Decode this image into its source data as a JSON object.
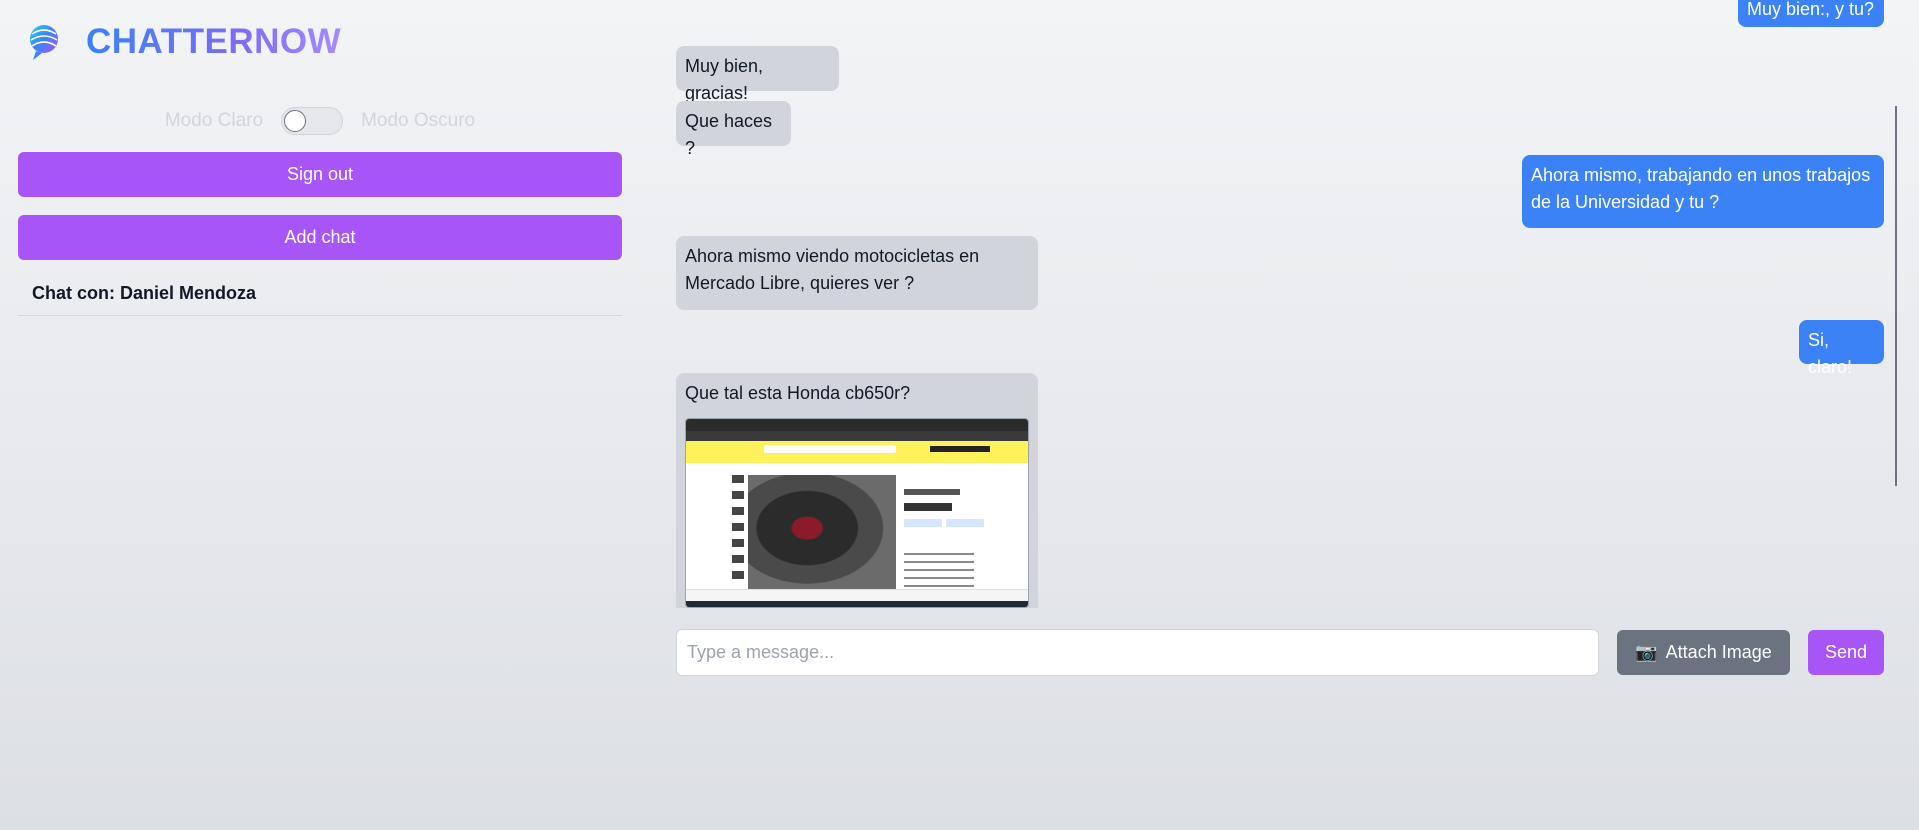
{
  "app": {
    "title": "CHATTERNOW",
    "logo_icon": "globe-chat-icon",
    "colors": {
      "accent_purple": "#a855f7",
      "outgoing_blue": "#3b82f6",
      "incoming_gray": "#d1d5db",
      "attach_gray": "#6b7280"
    }
  },
  "sidebar": {
    "mode_light_label": "Modo Claro",
    "mode_dark_label": "Modo Oscuro",
    "dark_mode_enabled": false,
    "sign_out_label": "Sign out",
    "add_chat_label": "Add chat",
    "chats": [
      {
        "label": "Chat con: Daniel Mendoza"
      }
    ]
  },
  "messages": [
    {
      "direction": "out",
      "text": "Muy bien:, y tu?"
    },
    {
      "direction": "in",
      "text": "Muy bien, gracias!"
    },
    {
      "direction": "in",
      "text": "Que haces ?"
    },
    {
      "direction": "out",
      "text": "Ahora mismo, trabajando en unos trabajos de la Universidad y tu ?"
    },
    {
      "direction": "in",
      "text": "Ahora mismo viendo motocicletas en Mercado Libre, quieres ver ?"
    },
    {
      "direction": "out",
      "text": "Si, claro!"
    },
    {
      "direction": "in",
      "text": "Que tal esta Honda cb650r?",
      "attachment": "mercado-libre-screenshot"
    }
  ],
  "composer": {
    "placeholder": "Type a message...",
    "value": "",
    "attach_label": "Attach Image",
    "attach_icon": "camera-icon",
    "send_label": "Send"
  }
}
